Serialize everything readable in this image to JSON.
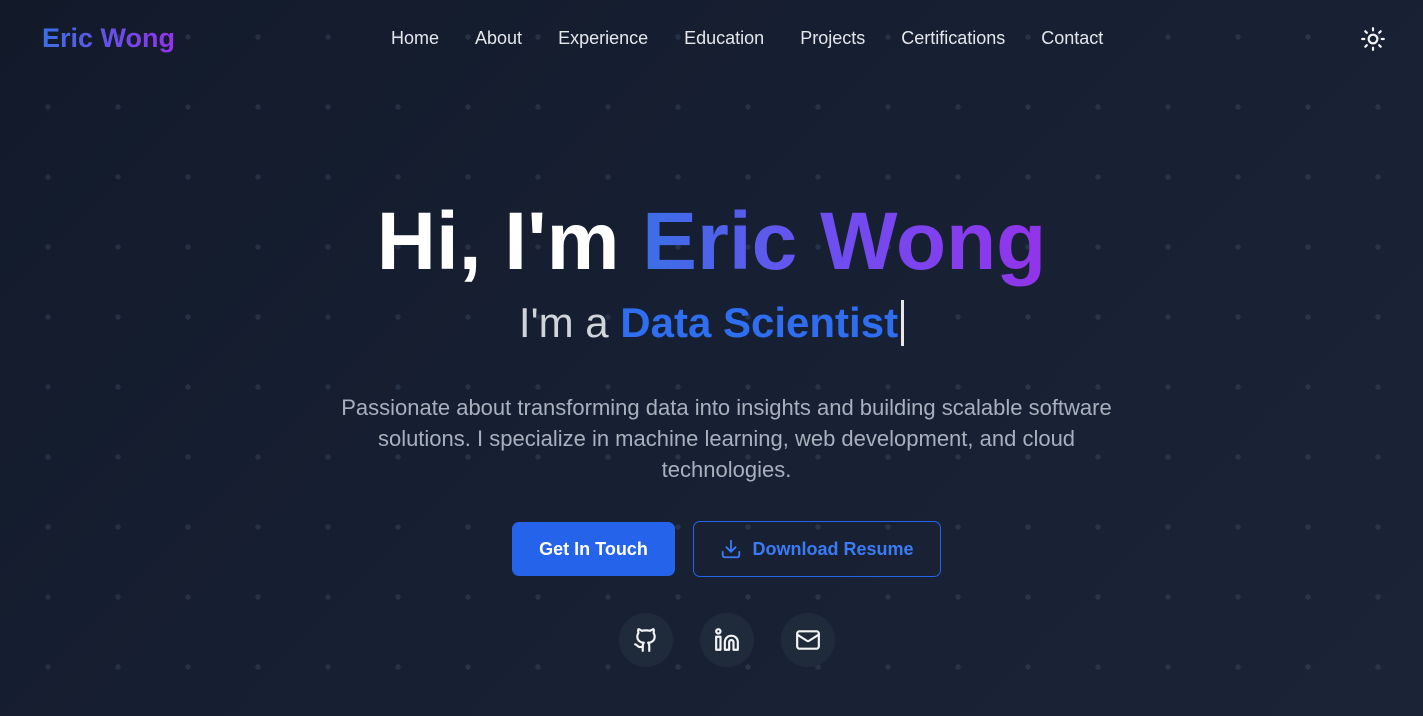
{
  "nav": {
    "brand": "Eric Wong",
    "links": [
      "Home",
      "About",
      "Experience",
      "Education",
      "Projects",
      "Certifications",
      "Contact"
    ],
    "theme_toggle_icon": "sun-icon"
  },
  "hero": {
    "greeting": "Hi, I'm",
    "name": "Eric Wong",
    "role_prefix": "I'm a",
    "role": "Data Scientist",
    "description": "Passionate about transforming data into insights and building scalable software solutions. I specialize in machine learning, web development, and cloud technologies."
  },
  "buttons": {
    "primary": "Get In Touch",
    "secondary": "Download Resume",
    "secondary_icon": "download-icon"
  },
  "social": {
    "icons": [
      "github-icon",
      "linkedin-icon",
      "mail-icon"
    ]
  },
  "colors": {
    "background": "#141c2c",
    "accent_blue": "#2563eb",
    "accent_purple": "#9333ea",
    "social_bg": "#1f2a3b"
  }
}
